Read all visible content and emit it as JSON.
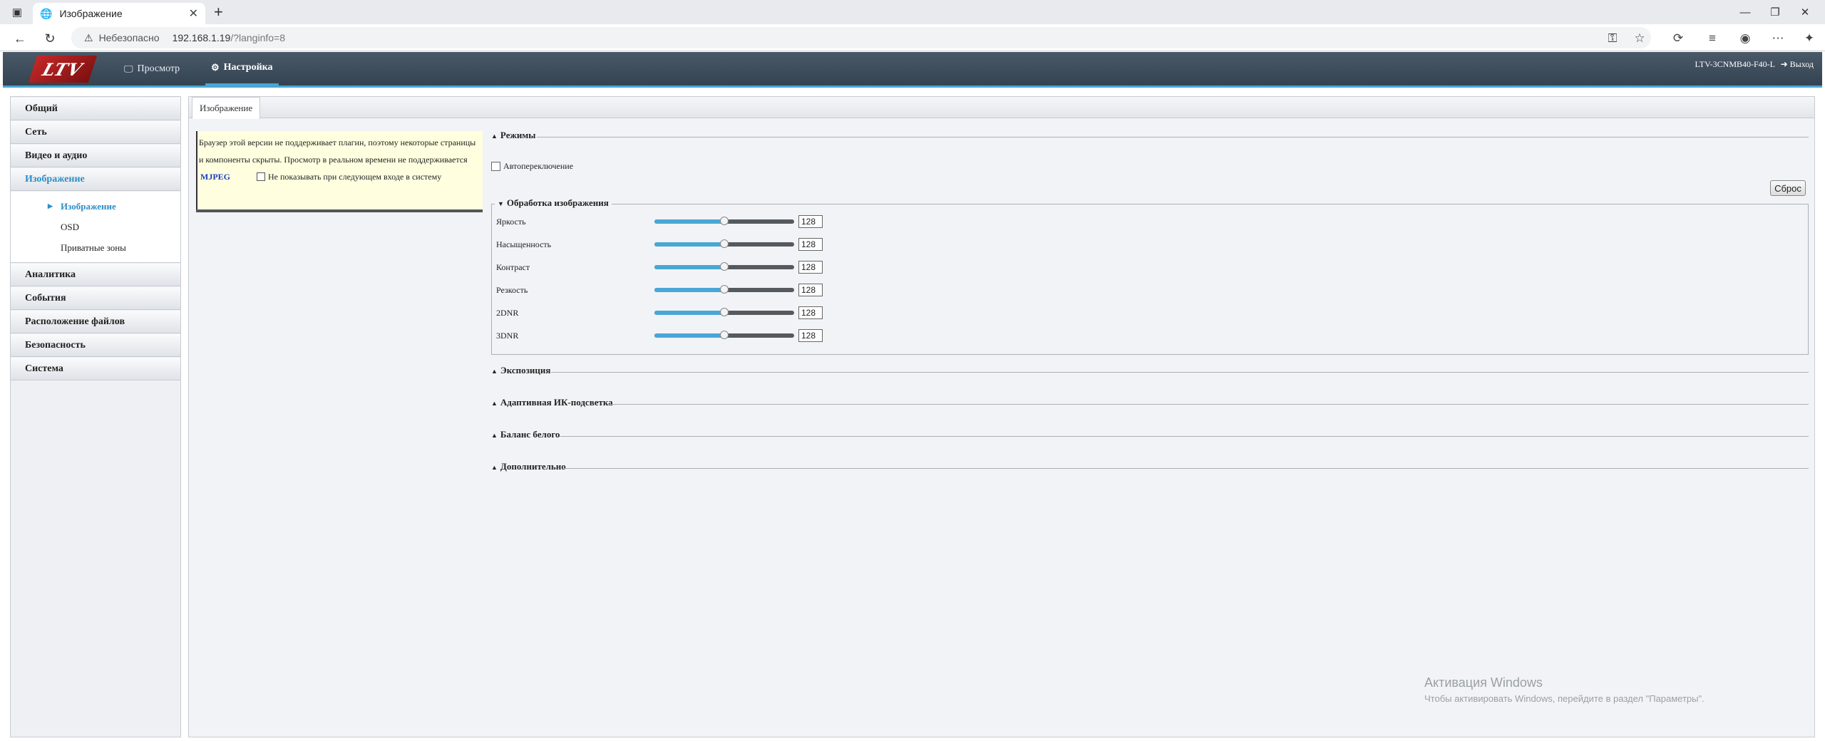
{
  "browser": {
    "tab_title": "Изображение",
    "tab_close": "✕",
    "new_tab": "+",
    "insecure_label": "Небезопасно",
    "url_host": "192.168.1.19",
    "url_path": "/?langinfo=8"
  },
  "header": {
    "logo_text": "LTV",
    "nav": [
      {
        "label": "Просмотр",
        "icon": "monitor-icon"
      },
      {
        "label": "Настройка",
        "icon": "gear-icon"
      }
    ],
    "model": "LTV-3CNMB40-F40-L",
    "logout": "Выход"
  },
  "sidebar": {
    "groups_top": [
      "Общий",
      "Сеть",
      "Видео и аудио",
      "Изображение"
    ],
    "subitems": [
      "Изображение",
      "OSD",
      "Приватные зоны"
    ],
    "groups_bottom": [
      "Аналитика",
      "События",
      "Расположение файлов",
      "Безопасность",
      "Система"
    ]
  },
  "main": {
    "tab": "Изображение",
    "notice": {
      "text": "Браузер этой версии не поддерживает плагин, поэтому некоторые страницы и компоненты скрыты. Просмотр в реальном времени не поддерживается",
      "mjpeg": "MJPEG",
      "checkbox_label": "Не показывать при следующем входе в систему"
    },
    "sections": {
      "modes": "Режимы",
      "auto_switch": "Автопереключение",
      "reset": "Сброс",
      "processing": "Обработка изображения",
      "exposure": "Экспозиция",
      "ir": "Адаптивная ИК-подсветка",
      "white_balance": "Баланс белого",
      "advanced": "Дополнительно"
    },
    "params": [
      {
        "label": "Яркость",
        "value": "128",
        "level": 0.5
      },
      {
        "label": "Насыщенность",
        "value": "128",
        "level": 0.5
      },
      {
        "label": "Контраст",
        "value": "128",
        "level": 0.5
      },
      {
        "label": "Резкость",
        "value": "128",
        "level": 0.5
      },
      {
        "label": "2DNR",
        "value": "128",
        "level": 0.5
      },
      {
        "label": "3DNR",
        "value": "128",
        "level": 0.5
      }
    ]
  },
  "watermark": {
    "title": "Активация Windows",
    "subtitle": "Чтобы активировать Windows, перейдите в раздел \"Параметры\"."
  },
  "colors": {
    "accent": "#4aa6d6",
    "header": "#3e4d5c",
    "active_text": "#2e8ec9"
  }
}
